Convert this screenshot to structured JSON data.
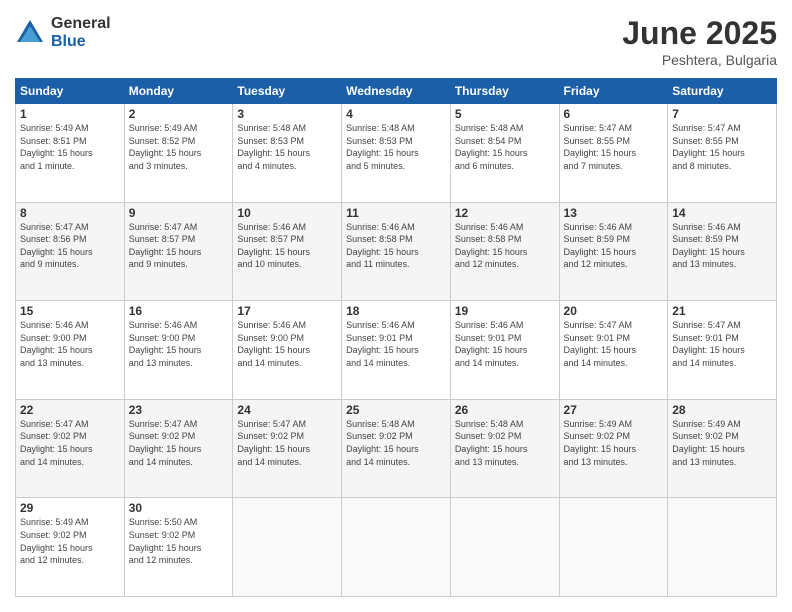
{
  "logo": {
    "general": "General",
    "blue": "Blue"
  },
  "header": {
    "month": "June 2025",
    "location": "Peshtera, Bulgaria"
  },
  "weekdays": [
    "Sunday",
    "Monday",
    "Tuesday",
    "Wednesday",
    "Thursday",
    "Friday",
    "Saturday"
  ],
  "weeks": [
    [
      {
        "day": "1",
        "info": "Sunrise: 5:49 AM\nSunset: 8:51 PM\nDaylight: 15 hours\nand 1 minute."
      },
      {
        "day": "2",
        "info": "Sunrise: 5:49 AM\nSunset: 8:52 PM\nDaylight: 15 hours\nand 3 minutes."
      },
      {
        "day": "3",
        "info": "Sunrise: 5:48 AM\nSunset: 8:53 PM\nDaylight: 15 hours\nand 4 minutes."
      },
      {
        "day": "4",
        "info": "Sunrise: 5:48 AM\nSunset: 8:53 PM\nDaylight: 15 hours\nand 5 minutes."
      },
      {
        "day": "5",
        "info": "Sunrise: 5:48 AM\nSunset: 8:54 PM\nDaylight: 15 hours\nand 6 minutes."
      },
      {
        "day": "6",
        "info": "Sunrise: 5:47 AM\nSunset: 8:55 PM\nDaylight: 15 hours\nand 7 minutes."
      },
      {
        "day": "7",
        "info": "Sunrise: 5:47 AM\nSunset: 8:55 PM\nDaylight: 15 hours\nand 8 minutes."
      }
    ],
    [
      {
        "day": "8",
        "info": "Sunrise: 5:47 AM\nSunset: 8:56 PM\nDaylight: 15 hours\nand 9 minutes."
      },
      {
        "day": "9",
        "info": "Sunrise: 5:47 AM\nSunset: 8:57 PM\nDaylight: 15 hours\nand 9 minutes."
      },
      {
        "day": "10",
        "info": "Sunrise: 5:46 AM\nSunset: 8:57 PM\nDaylight: 15 hours\nand 10 minutes."
      },
      {
        "day": "11",
        "info": "Sunrise: 5:46 AM\nSunset: 8:58 PM\nDaylight: 15 hours\nand 11 minutes."
      },
      {
        "day": "12",
        "info": "Sunrise: 5:46 AM\nSunset: 8:58 PM\nDaylight: 15 hours\nand 12 minutes."
      },
      {
        "day": "13",
        "info": "Sunrise: 5:46 AM\nSunset: 8:59 PM\nDaylight: 15 hours\nand 12 minutes."
      },
      {
        "day": "14",
        "info": "Sunrise: 5:46 AM\nSunset: 8:59 PM\nDaylight: 15 hours\nand 13 minutes."
      }
    ],
    [
      {
        "day": "15",
        "info": "Sunrise: 5:46 AM\nSunset: 9:00 PM\nDaylight: 15 hours\nand 13 minutes."
      },
      {
        "day": "16",
        "info": "Sunrise: 5:46 AM\nSunset: 9:00 PM\nDaylight: 15 hours\nand 13 minutes."
      },
      {
        "day": "17",
        "info": "Sunrise: 5:46 AM\nSunset: 9:00 PM\nDaylight: 15 hours\nand 14 minutes."
      },
      {
        "day": "18",
        "info": "Sunrise: 5:46 AM\nSunset: 9:01 PM\nDaylight: 15 hours\nand 14 minutes."
      },
      {
        "day": "19",
        "info": "Sunrise: 5:46 AM\nSunset: 9:01 PM\nDaylight: 15 hours\nand 14 minutes."
      },
      {
        "day": "20",
        "info": "Sunrise: 5:47 AM\nSunset: 9:01 PM\nDaylight: 15 hours\nand 14 minutes."
      },
      {
        "day": "21",
        "info": "Sunrise: 5:47 AM\nSunset: 9:01 PM\nDaylight: 15 hours\nand 14 minutes."
      }
    ],
    [
      {
        "day": "22",
        "info": "Sunrise: 5:47 AM\nSunset: 9:02 PM\nDaylight: 15 hours\nand 14 minutes."
      },
      {
        "day": "23",
        "info": "Sunrise: 5:47 AM\nSunset: 9:02 PM\nDaylight: 15 hours\nand 14 minutes."
      },
      {
        "day": "24",
        "info": "Sunrise: 5:47 AM\nSunset: 9:02 PM\nDaylight: 15 hours\nand 14 minutes."
      },
      {
        "day": "25",
        "info": "Sunrise: 5:48 AM\nSunset: 9:02 PM\nDaylight: 15 hours\nand 14 minutes."
      },
      {
        "day": "26",
        "info": "Sunrise: 5:48 AM\nSunset: 9:02 PM\nDaylight: 15 hours\nand 13 minutes."
      },
      {
        "day": "27",
        "info": "Sunrise: 5:49 AM\nSunset: 9:02 PM\nDaylight: 15 hours\nand 13 minutes."
      },
      {
        "day": "28",
        "info": "Sunrise: 5:49 AM\nSunset: 9:02 PM\nDaylight: 15 hours\nand 13 minutes."
      }
    ],
    [
      {
        "day": "29",
        "info": "Sunrise: 5:49 AM\nSunset: 9:02 PM\nDaylight: 15 hours\nand 12 minutes."
      },
      {
        "day": "30",
        "info": "Sunrise: 5:50 AM\nSunset: 9:02 PM\nDaylight: 15 hours\nand 12 minutes."
      },
      null,
      null,
      null,
      null,
      null
    ]
  ]
}
